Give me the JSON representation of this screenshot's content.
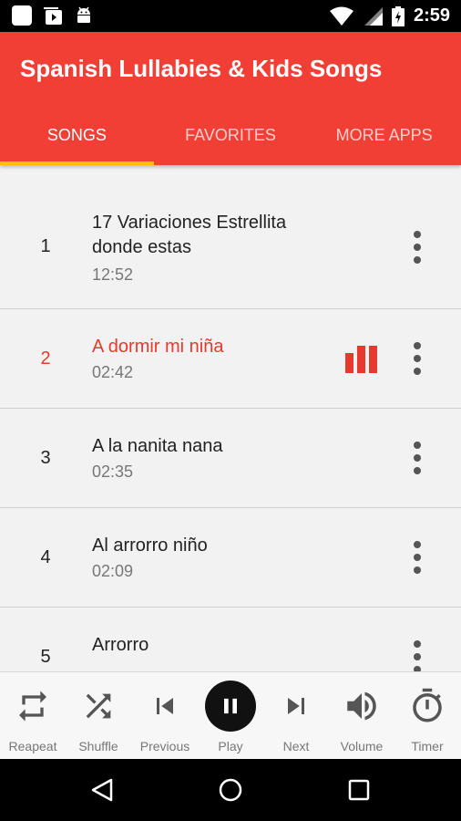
{
  "status_bar": {
    "time": "2:59",
    "left_icons": [
      "app-square-icon",
      "youtube-icon",
      "android-icon"
    ],
    "right_icons": [
      "wifi-icon",
      "signal-icon",
      "battery-charging-icon"
    ]
  },
  "app": {
    "title": "Spanish Lullabies & Kids Songs",
    "primary_color": "#f23f35",
    "accent_color": "#ffc107"
  },
  "tabs": [
    {
      "label": "SONGS",
      "active": true
    },
    {
      "label": "FAVORITES",
      "active": false
    },
    {
      "label": "MORE APPS",
      "active": false
    }
  ],
  "songs": [
    {
      "number": "1",
      "title": "17 Variaciones Estrellita donde estas",
      "duration": "12:52",
      "playing": false
    },
    {
      "number": "2",
      "title": "A dormir mi niña",
      "duration": "02:42",
      "playing": true
    },
    {
      "number": "3",
      "title": "A la nanita nana",
      "duration": "02:35",
      "playing": false
    },
    {
      "number": "4",
      "title": "Al arrorro niño",
      "duration": "02:09",
      "playing": false
    },
    {
      "number": "5",
      "title": "Arrorro",
      "duration": "",
      "playing": false
    }
  ],
  "player": {
    "controls": [
      {
        "label": "Reapeat",
        "icon": "repeat-icon"
      },
      {
        "label": "Shuffle",
        "icon": "shuffle-icon"
      },
      {
        "label": "Previous",
        "icon": "skip-previous-icon"
      },
      {
        "label": "Play",
        "icon": "pause-icon"
      },
      {
        "label": "Next",
        "icon": "skip-next-icon"
      },
      {
        "label": "Volume",
        "icon": "volume-icon"
      },
      {
        "label": "Timer",
        "icon": "timer-icon"
      }
    ]
  },
  "nav_bar": {
    "icons": [
      "back-icon",
      "home-icon",
      "recents-icon"
    ]
  }
}
